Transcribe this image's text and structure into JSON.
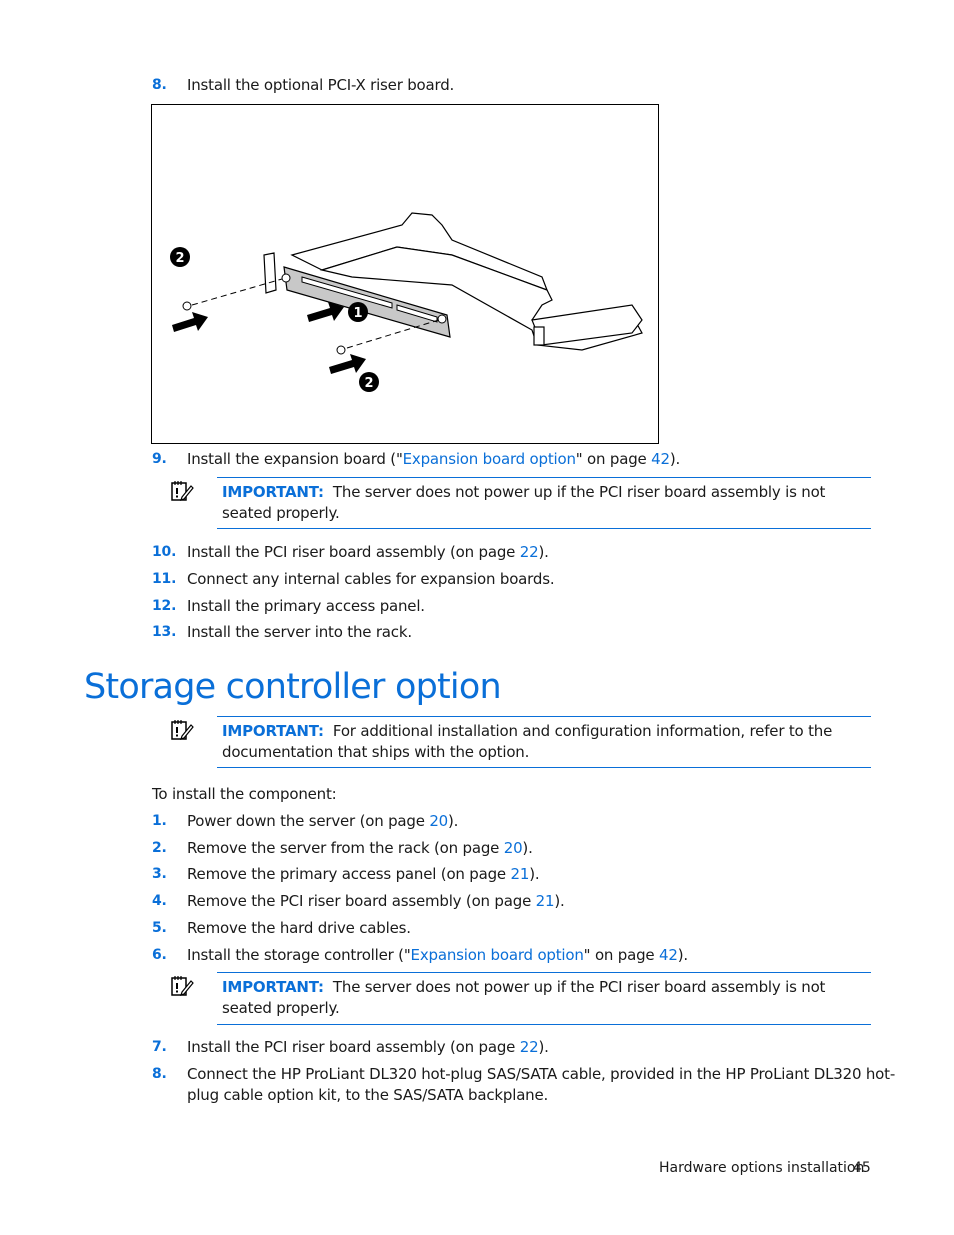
{
  "steps_top": [
    {
      "num": "8.",
      "parts": [
        {
          "t": "Install the optional PCI-X riser board."
        }
      ]
    },
    {
      "num": "9.",
      "parts": [
        {
          "t": "Install the expansion board (\""
        },
        {
          "t": "Expansion board option",
          "link": true
        },
        {
          "t": "\" on page "
        },
        {
          "t": "42",
          "link": true
        },
        {
          "t": ")."
        }
      ]
    },
    {
      "num": "10.",
      "parts": [
        {
          "t": "Install the PCI riser board assembly (on page "
        },
        {
          "t": "22",
          "link": true
        },
        {
          "t": ")."
        }
      ]
    },
    {
      "num": "11.",
      "parts": [
        {
          "t": "Connect any internal cables for expansion boards."
        }
      ]
    },
    {
      "num": "12.",
      "parts": [
        {
          "t": "Install the primary access panel."
        }
      ]
    },
    {
      "num": "13.",
      "parts": [
        {
          "t": "Install the server into the rack."
        }
      ]
    }
  ],
  "figure": {
    "callouts": [
      "1",
      "2",
      "2"
    ],
    "description": "PCI-X riser board installation illustration"
  },
  "notes": [
    {
      "label": "IMPORTANT:",
      "text": "The server does not power up if the PCI riser board assembly is not seated properly."
    },
    {
      "label": "IMPORTANT:",
      "text": "For additional installation and configuration information, refer to the documentation that ships with the option."
    },
    {
      "label": "IMPORTANT:",
      "text": "The server does not power up if the PCI riser board assembly is not seated properly."
    }
  ],
  "section": {
    "title": "Storage controller option",
    "intro": "To install the component:"
  },
  "steps_bottom": [
    {
      "num": "1.",
      "parts": [
        {
          "t": "Power down the server (on page "
        },
        {
          "t": "20",
          "link": true
        },
        {
          "t": ")."
        }
      ]
    },
    {
      "num": "2.",
      "parts": [
        {
          "t": "Remove the server from the rack (on page "
        },
        {
          "t": "20",
          "link": true
        },
        {
          "t": ")."
        }
      ]
    },
    {
      "num": "3.",
      "parts": [
        {
          "t": "Remove the primary access panel (on page "
        },
        {
          "t": "21",
          "link": true
        },
        {
          "t": ")."
        }
      ]
    },
    {
      "num": "4.",
      "parts": [
        {
          "t": "Remove the PCI riser board assembly (on page "
        },
        {
          "t": "21",
          "link": true
        },
        {
          "t": ")."
        }
      ]
    },
    {
      "num": "5.",
      "parts": [
        {
          "t": "Remove the hard drive cables."
        }
      ]
    },
    {
      "num": "6.",
      "parts": [
        {
          "t": "Install the storage controller (\""
        },
        {
          "t": "Expansion board option",
          "link": true
        },
        {
          "t": "\" on page "
        },
        {
          "t": "42",
          "link": true
        },
        {
          "t": ")."
        }
      ]
    },
    {
      "num": "7.",
      "parts": [
        {
          "t": "Install the PCI riser board assembly (on page "
        },
        {
          "t": "22",
          "link": true
        },
        {
          "t": ")."
        }
      ]
    },
    {
      "num": "8.",
      "line1": "Connect the HP ProLiant DL320 hot-plug SAS/SATA cable, provided in the HP ProLiant DL320 hot-",
      "line2": "plug cable option kit, to the SAS/SATA backplane."
    }
  ],
  "footer": {
    "section": "Hardware options installation",
    "page": "45"
  },
  "colors": {
    "accent": "#0a6fd8",
    "text": "#1a1a1a"
  }
}
